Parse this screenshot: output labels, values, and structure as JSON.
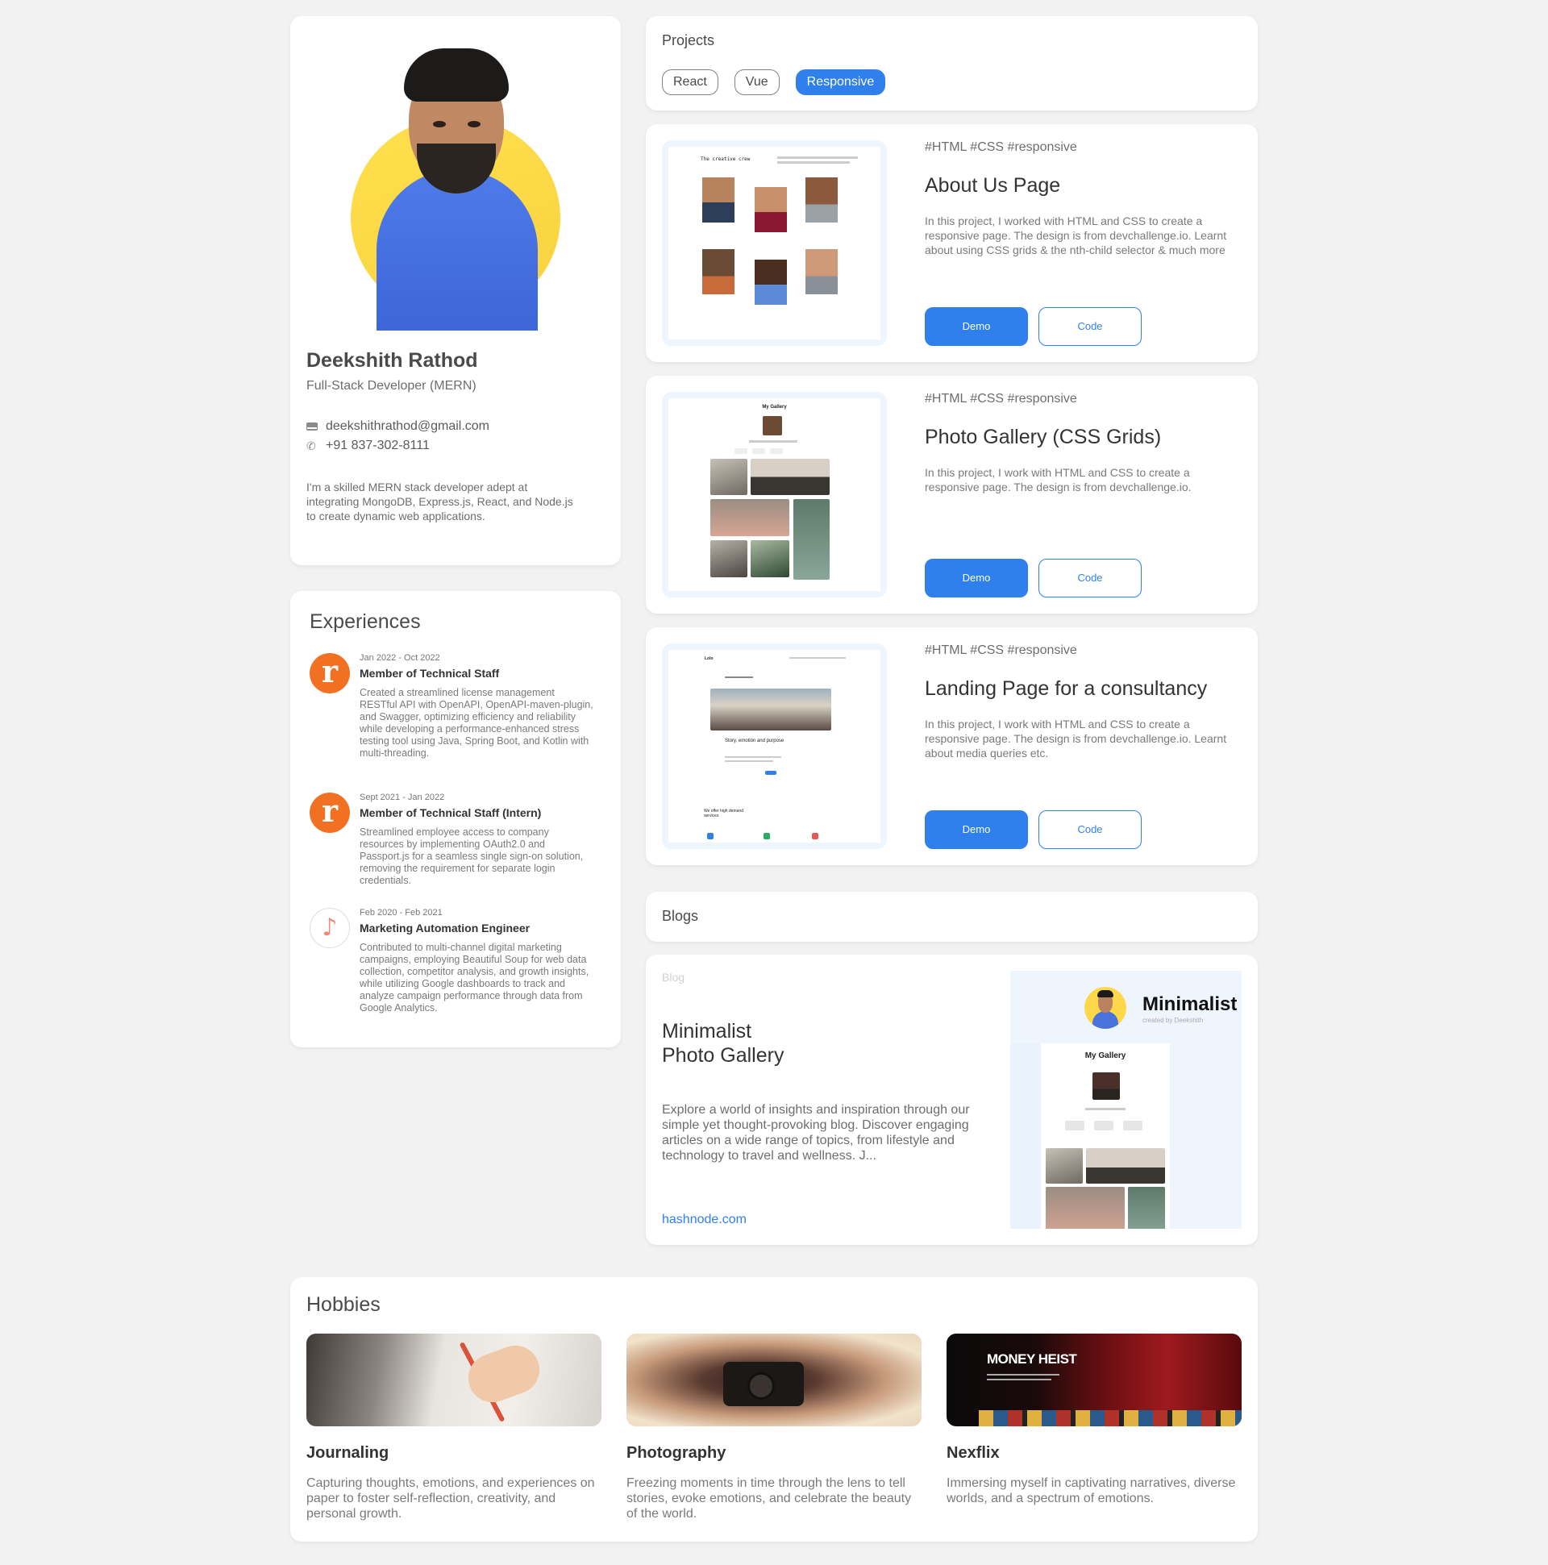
{
  "profile": {
    "name": "Deekshith Rathod",
    "role": "Full-Stack Developer (MERN)",
    "email": "deekshithrathod@gmail.com",
    "phone": "+91 837-302-8111",
    "bio": "I'm a skilled MERN stack developer adept at integrating MongoDB, Express.js, React, and Node.js to create dynamic web applications."
  },
  "experiences": {
    "title": "Experiences",
    "items": [
      {
        "date": "Jan 2022 - Oct 2022",
        "role": "Member of Technical Staff",
        "logo": "r",
        "desc": "Created a streamlined license management RESTful API with OpenAPI, OpenAPI-maven-plugin, and Swagger, optimizing efficiency and reliability while developing a performance-enhanced stress testing tool using Java, Spring Boot, and Kotlin with multi-threading."
      },
      {
        "date": "Sept 2021 - Jan 2022",
        "role": "Member of Technical Staff (Intern)",
        "logo": "r",
        "desc": "Streamlined employee access to company resources by implementing OAuth2.0 and Passport.js for a seamless single sign-on solution, removing the requirement for separate login credentials."
      },
      {
        "date": "Feb 2020 - Feb 2021",
        "role": "Marketing Automation Engineer",
        "logo": "♪",
        "desc": "Contributed to multi-channel digital marketing campaigns, employing Beautiful Soup for web data collection, competitor analysis, and growth insights, while utilizing Google dashboards to track and analyze campaign performance through data from Google Analytics."
      }
    ]
  },
  "projects": {
    "title": "Projects",
    "filters": [
      "React",
      "Vue",
      "Responsive"
    ],
    "active_filter": "Responsive",
    "items": [
      {
        "tags": "#HTML #CSS #responsive",
        "title": "About Us Page",
        "desc": "In this project, I worked with HTML and CSS to create a responsive page. The design is from devchallenge.io. Learnt about using CSS grids & the nth-child selector & much more",
        "demo": "Demo",
        "code": "Code"
      },
      {
        "tags": "#HTML #CSS #responsive",
        "title": "Photo Gallery (CSS Grids)",
        "desc": "In this project, I work with HTML and CSS to create a responsive page. The design is from devchallenge.io.",
        "demo": "Demo",
        "code": "Code"
      },
      {
        "tags": "#HTML #CSS #responsive",
        "title": "Landing Page for a consultancy",
        "desc": "In this project, I work with HTML and CSS to create a responsive page. The design is from devchallenge.io. Learnt about media queries etc.",
        "demo": "Demo",
        "code": "Code"
      }
    ],
    "thumbs": {
      "about_heading": "The creative crew",
      "gallery_heading": "My Gallery",
      "landing_logo": "Lolo",
      "landing_headline": "Story, emotion and purpose",
      "landing_services": "We offer high demand services"
    }
  },
  "blogs": {
    "title": "Blogs",
    "item": {
      "tag": "Blog",
      "title_line1": "Minimalist",
      "title_line2": "Photo Gallery",
      "desc": "Explore a world of insights and inspiration through our simple yet thought-provoking blog. Discover engaging articles on a wide range of topics, from lifestyle and technology to travel and wellness. J...",
      "link": "hashnode.com",
      "image_title": "Minimalist",
      "image_sub": "created by Deekshith",
      "image_gallery": "My Gallery"
    }
  },
  "hobbies": {
    "title": "Hobbies",
    "items": [
      {
        "name": "Journaling",
        "desc": "Capturing thoughts, emotions, and experiences on paper to foster self-reflection, creativity, and personal growth."
      },
      {
        "name": "Photography",
        "desc": "Freezing moments in time through the lens to tell stories, evoke emotions, and celebrate the beauty of the world."
      },
      {
        "name": "Nexflix",
        "desc": "Immersing myself in captivating narratives, diverse worlds, and a spectrum of emotions."
      }
    ],
    "netflix_banner": "MONEY HEIST"
  },
  "colors": {
    "accent": "#2f80ed",
    "background": "#f2f2f2",
    "card": "#ffffff",
    "avatar_bg": "#ffd84a",
    "exp_logo": "#f27021"
  }
}
